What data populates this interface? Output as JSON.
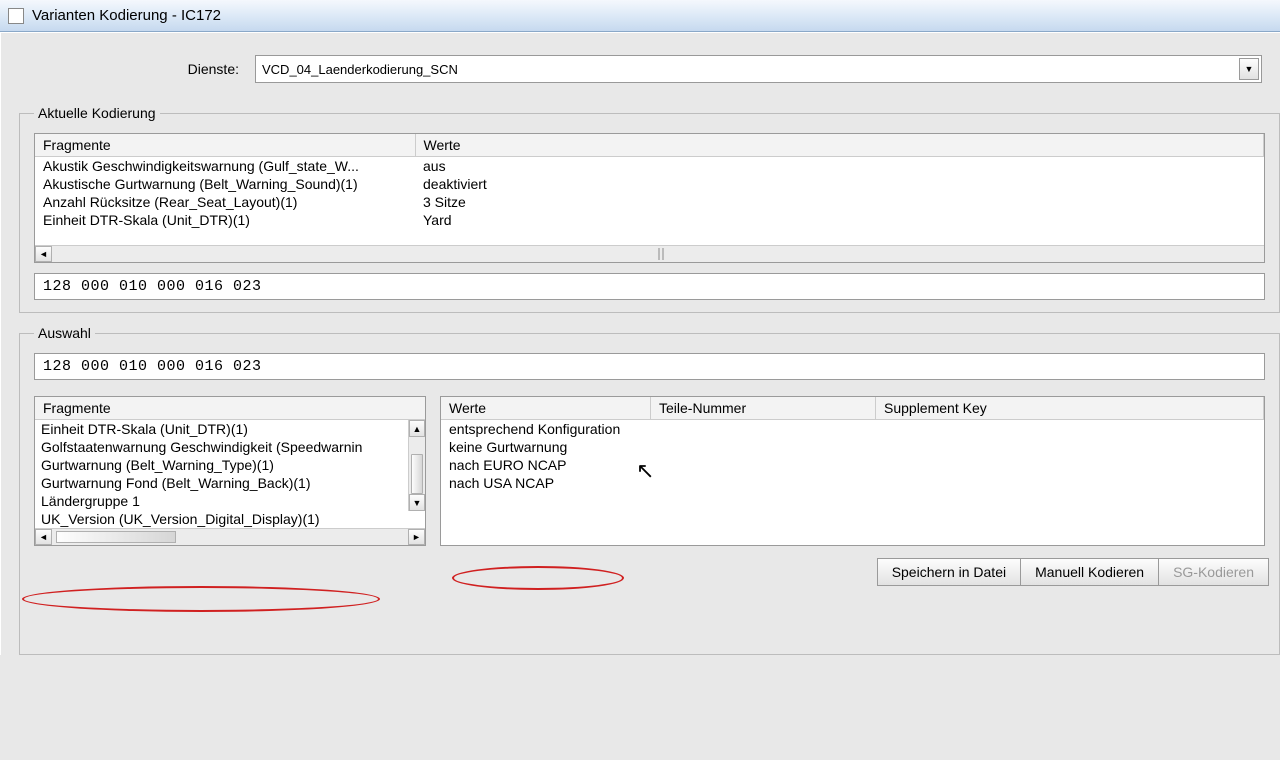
{
  "window": {
    "title": "Varianten Kodierung - IC172"
  },
  "dienste": {
    "label": "Dienste:",
    "value": "VCD_04_Laenderkodierung_SCN"
  },
  "aktuelle": {
    "legend": "Aktuelle Kodierung",
    "headers": {
      "fragmente": "Fragmente",
      "werte": "Werte"
    },
    "rows": [
      {
        "frag": "Akustik Geschwindigkeitswarnung (Gulf_state_W...",
        "wert": "aus"
      },
      {
        "frag": "Akustische Gurtwarnung (Belt_Warning_Sound)(1)",
        "wert": "deaktiviert"
      },
      {
        "frag": "Anzahl Rücksitze (Rear_Seat_Layout)(1)",
        "wert": "3 Sitze"
      },
      {
        "frag": "Einheit DTR-Skala (Unit_DTR)(1)",
        "wert": "Yard"
      }
    ],
    "code": "128  000  010  000  016  023"
  },
  "auswahl": {
    "legend": "Auswahl",
    "code": "128  000  010  000  016  023",
    "frag_header": "Fragmente",
    "frag_items": [
      "Einheit DTR-Skala (Unit_DTR)(1)",
      "Golfstaatenwarnung Geschwindigkeit (Speedwarnin",
      "Gurtwarnung (Belt_Warning_Type)(1)",
      "Gurtwarnung Fond (Belt_Warning_Back)(1)",
      "Ländergruppe 1",
      "UK_Version (UK_Version_Digital_Display)(1)"
    ],
    "werte_headers": {
      "werte": "Werte",
      "teile": "Teile-Nummer",
      "supp": "Supplement Key"
    },
    "werte_items": [
      "entsprechend Konfiguration",
      "keine Gurtwarnung",
      "nach EURO NCAP",
      "nach USA NCAP"
    ]
  },
  "buttons": {
    "save": "Speichern in Datei",
    "manual": "Manuell Kodieren",
    "sg": "SG-Kodieren"
  }
}
